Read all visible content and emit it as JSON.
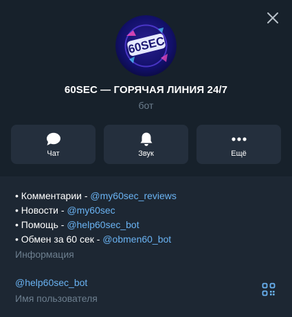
{
  "profile": {
    "avatar_text": "60SEC",
    "title": "60SEC — ГОРЯЧАЯ ЛИНИЯ 24/7",
    "subtitle": "бот"
  },
  "actions": [
    {
      "label": "Чат",
      "icon": "chat-bubble-icon"
    },
    {
      "label": "Звук",
      "icon": "bell-icon"
    },
    {
      "label": "Ещё",
      "icon": "more-dots-icon"
    }
  ],
  "info": {
    "lines": [
      {
        "prefix": "• Комментарии - ",
        "link": "@my60sec_reviews"
      },
      {
        "prefix": "• Новости - ",
        "link": "@my60sec"
      },
      {
        "prefix": "• Помощь - ",
        "link": "@help60sec_bot"
      },
      {
        "prefix": "• Обмен за 60 сек - ",
        "link": "@obmen60_bot"
      }
    ],
    "caption": "Информация"
  },
  "username": {
    "value": "@help60sec_bot",
    "caption": "Имя пользователя"
  },
  "colors": {
    "background": "#1d2733",
    "panel": "#17212b",
    "button": "#242f3d",
    "link": "#6ab3f3",
    "muted": "#6d7f8f"
  }
}
